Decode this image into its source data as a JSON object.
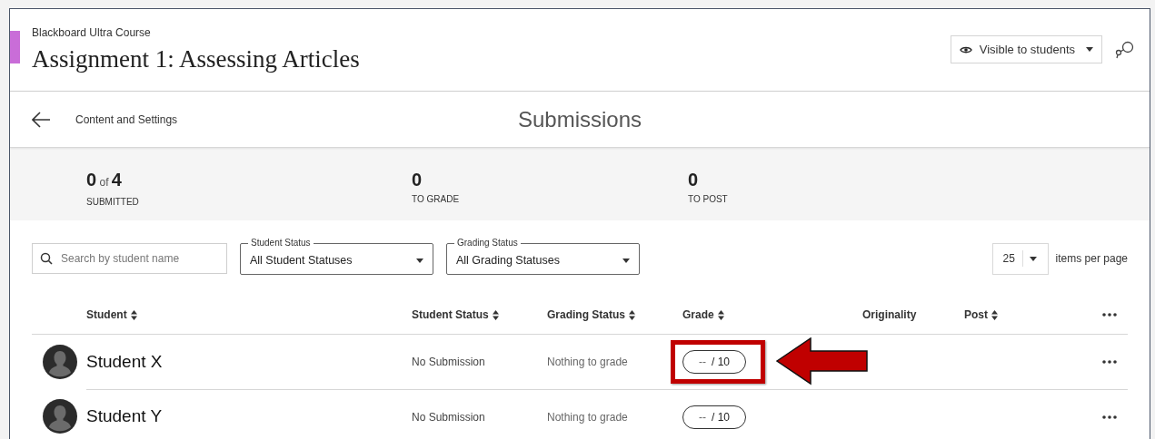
{
  "header": {
    "course": "Blackboard Ultra Course",
    "title": "Assignment 1: Assessing Articles",
    "visibility": "Visible to students"
  },
  "nav": {
    "back_label": "Content and Settings",
    "heading": "Submissions"
  },
  "stats": [
    {
      "value": "0",
      "of": "of",
      "total": "4",
      "label": "SUBMITTED"
    },
    {
      "value": "0",
      "label": "TO GRADE"
    },
    {
      "value": "0",
      "label": "TO POST"
    }
  ],
  "filters": {
    "search": {
      "placeholder": "Search by student name"
    },
    "dropdowns": [
      {
        "label": "Student Status",
        "value": "All Student Statuses"
      },
      {
        "label": "Grading Status",
        "value": "All Grading Statuses"
      }
    ],
    "page_size": "25",
    "page_size_label": "items per page"
  },
  "table": {
    "columns": [
      "Student",
      "Student Status",
      "Grading Status",
      "Grade",
      "Originality",
      "Post"
    ],
    "sortable": [
      true,
      true,
      true,
      true,
      false,
      true
    ],
    "rows": [
      {
        "student": "Student X",
        "student_status": "No Submission",
        "grading_status": "Nothing to grade",
        "grade": "--",
        "out_of": "/ 10",
        "highlighted": true
      },
      {
        "student": "Student Y",
        "student_status": "No Submission",
        "grading_status": "Nothing to grade",
        "grade": "--",
        "out_of": "/ 10",
        "highlighted": false
      }
    ]
  }
}
